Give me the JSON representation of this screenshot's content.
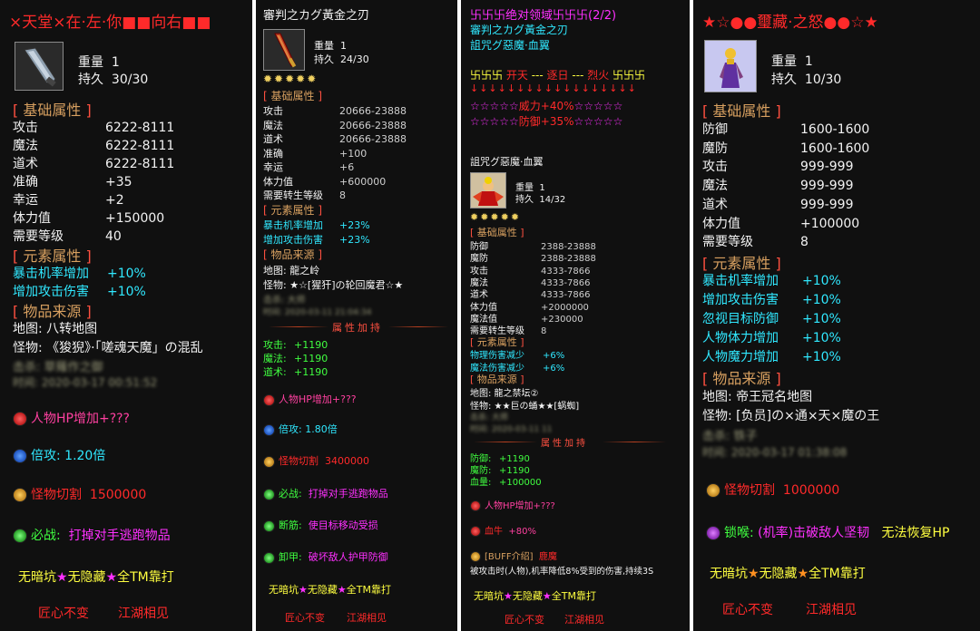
{
  "p1": {
    "title": "×天堂×在·左·你■■向右■■",
    "weight_label": "重量",
    "weight": "1",
    "dur_label": "持久",
    "dur": "30/30",
    "base_title": "基础属性",
    "base": [
      [
        "攻击",
        "6222-8111"
      ],
      [
        "魔法",
        "6222-8111"
      ],
      [
        "道术",
        "6222-8111"
      ],
      [
        "准确",
        "+35"
      ],
      [
        "幸运",
        "+2"
      ],
      [
        "体力值",
        "+150000"
      ],
      [
        "需要等级",
        "40"
      ]
    ],
    "elem_title": "元素属性",
    "elem": [
      [
        "暴击机率增加",
        "+10%"
      ],
      [
        "增加攻击伤害",
        "+10%"
      ]
    ],
    "src_title": "物品来源",
    "map": "地图: 八转地图",
    "monster": "怪物: 《狻猊》·「嗟魂天魔」の混乱",
    "blur1": "击杀: 草薙作之御",
    "blur2": "时间: 2020-03-17 00:51:52",
    "hp": "人物HP增加+???",
    "mult": "倍攻: 1.20倍",
    "cut_label": "怪物切割",
    "cut": "1500000",
    "must_label": "必战:",
    "must": "打掉对手逃跑物品",
    "noitem": [
      "无暗坑",
      "★",
      "无隐藏",
      "★",
      "全TM靠打"
    ],
    "footer": [
      "匠心不变",
      "江湖相见"
    ]
  },
  "p2": {
    "title": "審判之カグ黃金之刃",
    "weight_label": "重量",
    "weight": "1",
    "dur_label": "持久",
    "dur": "24/30",
    "stars": "✹✹✹✹✹",
    "base_title": "基础属性",
    "base": [
      [
        "攻击",
        "20666-23888"
      ],
      [
        "魔法",
        "20666-23888"
      ],
      [
        "道术",
        "20666-23888"
      ],
      [
        "准确",
        "+100"
      ],
      [
        "幸运",
        "+6"
      ],
      [
        "体力值",
        "+600000"
      ],
      [
        "需要转生等级",
        "8"
      ]
    ],
    "elem_title": "元素属性",
    "elem": [
      [
        "暴击机率增加",
        "+23%"
      ],
      [
        "增加攻击伤害",
        "+23%"
      ]
    ],
    "src_title": "物品来源",
    "map": "地图: 龍之岭",
    "monster": "怪物: ★☆[猩犴]の轮回魔君☆★",
    "blur1": "击杀: 大师",
    "blur2": "时间: 2020-03-11 21:04:34",
    "bonus_title": "属性加持",
    "bonus": [
      [
        "攻击:",
        "+1190"
      ],
      [
        "魔法:",
        "+1190"
      ],
      [
        "道术:",
        "+1190"
      ]
    ],
    "hp": "人物HP增加+???",
    "mult": "倍攻: 1.80倍",
    "cut_label": "怪物切割",
    "cut": "3400000",
    "must_label": "必战:",
    "must": "打掉对手逃跑物品",
    "slow_label": "断筋:",
    "slow": "使目标移动受损",
    "armor_label": "卸甲:",
    "armor": "破坏敌人护甲防御",
    "noitem": [
      "无暗坑",
      "★",
      "无隐藏",
      "★",
      "全TM靠打"
    ],
    "footer": [
      "匠心不变",
      "江湖相见"
    ]
  },
  "p3": {
    "set_title": "卐卐卐绝对领域卐卐卐(2/2)",
    "set_item1": "審判之カグ黃金之刃",
    "set_item2": "詛咒グ惡魔·血翼",
    "seal": [
      "卐卐卐",
      "开天",
      "---",
      "逐日",
      "---",
      "烈火",
      "卐卐卐"
    ],
    "arrows": "↓↓↓↓↓↓↓↓↓↓↓↓↓↓↓↓↓↓",
    "bonus1": [
      "☆☆☆☆☆",
      "威力+40%",
      "☆☆☆☆☆"
    ],
    "bonus2": [
      "☆☆☆☆☆",
      "防御+35%",
      "☆☆☆☆☆"
    ],
    "title": "詛咒グ惡魔·血翼",
    "weight_label": "重量",
    "weight": "1",
    "dur_label": "持久",
    "dur": "14/32",
    "stars": "✹✹✹✹✹",
    "base_title": "基础属性",
    "base": [
      [
        "防御",
        "2388-23888"
      ],
      [
        "魔防",
        "2388-23888"
      ],
      [
        "攻击",
        "4333-7866"
      ],
      [
        "魔法",
        "4333-7866"
      ],
      [
        "道术",
        "4333-7866"
      ],
      [
        "体力值",
        "+2000000"
      ],
      [
        "魔法值",
        "+230000"
      ],
      [
        "需要转生等级",
        "8"
      ]
    ],
    "elem_title": "元素属性",
    "elem": [
      [
        "物理伤害减少",
        "+6%"
      ],
      [
        "魔法伤害减少",
        "+6%"
      ]
    ],
    "src_title": "物品来源",
    "map": "地图: 龍之禁坛②",
    "monster": "怪物: ★★巨の蛹★★[蜗蜘]",
    "blur1": "击杀: 大师",
    "blur2": "时间: 2020-03-11 11",
    "bonus_title": "属性加持",
    "bonus": [
      [
        "防御:",
        "+1190"
      ],
      [
        "魔防:",
        "+1190"
      ],
      [
        "血量:",
        "+100000"
      ]
    ],
    "hp": "人物HP增加+???",
    "blood_label": "血牛",
    "blood": "+80%",
    "buff_label": "[BUFF介绍]",
    "buff_name": "鹿魔",
    "buff_desc": "被攻击时(人物),机率降低8%受到的伤害,持续3S",
    "noitem": [
      "无暗坑",
      "★",
      "无隐藏",
      "★",
      "全TM靠打"
    ],
    "footer": [
      "匠心不变",
      "江湖相见"
    ]
  },
  "p4": {
    "title": "★☆●●璽藏·之怒●●☆★",
    "weight_label": "重量",
    "weight": "1",
    "dur_label": "持久",
    "dur": "10/30",
    "base_title": "基础属性",
    "base": [
      [
        "防御",
        "1600-1600"
      ],
      [
        "魔防",
        "1600-1600"
      ],
      [
        "攻击",
        "999-999"
      ],
      [
        "魔法",
        "999-999"
      ],
      [
        "道术",
        "999-999"
      ],
      [
        "体力值",
        "+100000"
      ],
      [
        "需要等级",
        "8"
      ]
    ],
    "elem_title": "元素属性",
    "elem": [
      [
        "暴击机率增加",
        "+10%"
      ],
      [
        "增加攻击伤害",
        "+10%"
      ],
      [
        "忽视目标防御",
        "+10%"
      ],
      [
        "人物体力增加",
        "+10%"
      ],
      [
        "人物魔力增加",
        "+10%"
      ]
    ],
    "src_title": "物品来源",
    "map": "地图: 帝王冠名地图",
    "monster": "怪物: [负员]の×通×天×魔の王",
    "blur1": "击杀: 铁子",
    "blur2": "时间: 2020-03-17 01:38:08",
    "cut_label": "怪物切割",
    "cut": "1000000",
    "lock_label": "锁喉:",
    "lock": "(机率)击破敌人坚韧",
    "lock2": "无法恢复HP",
    "noitem": [
      "无暗坑",
      "★",
      "无隐藏",
      "★",
      "全TM靠打"
    ],
    "footer": [
      "匠心不变",
      "江湖相见"
    ]
  }
}
